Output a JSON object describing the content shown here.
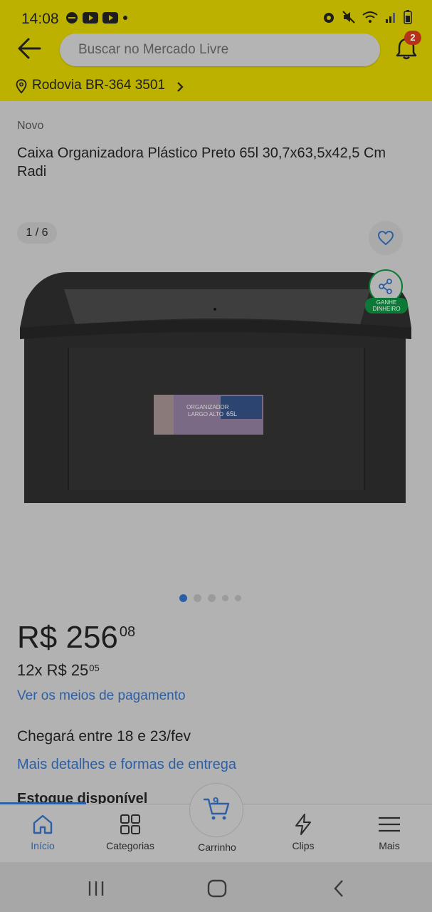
{
  "status_bar": {
    "time": "14:08",
    "left_icons": [
      "edge-icon",
      "youtube-icon",
      "youtube-icon",
      "dot"
    ],
    "right_icons": [
      "alarm-icon",
      "mute-icon",
      "wifi-icon",
      "signal-icon",
      "battery-icon"
    ]
  },
  "header": {
    "search_placeholder": "Buscar no Mercado Livre",
    "notification_count": "2"
  },
  "address": {
    "label": "Rodovia BR-364 3501"
  },
  "product": {
    "condition": "Novo",
    "title": "Caixa Organizadora Plástico Preto 65l 30,7x63,5x42,5 Cm Radi",
    "image_counter": "1 / 6",
    "share_badge": "GANHE DINHEIRO",
    "carousel_total": 5,
    "carousel_active": 1,
    "box_label": {
      "line1": "ORGANIZADOR",
      "line2": "LARGO ALTO",
      "size": "65L"
    },
    "price_main": "R$ 256",
    "price_cents": "08",
    "installments_main": "12x R$ 25",
    "installments_cents": "05",
    "payment_link": "Ver os meios de pagamento",
    "delivery": "Chegará entre 18 e 23/fev",
    "delivery_link": "Mais detalhes e formas de entrega",
    "stock": "Estoque disponível"
  },
  "tabs": {
    "inicio": "Início",
    "categorias": "Categorias",
    "carrinho": "Carrinho",
    "cart_count": "9",
    "clips": "Clips",
    "mais": "Mais"
  },
  "colors": {
    "header": "#bdb100",
    "accent_blue": "#2f5fa3",
    "share_green": "#0c7a36",
    "badge_red": "#b53318",
    "background": "#b2b2b2"
  }
}
